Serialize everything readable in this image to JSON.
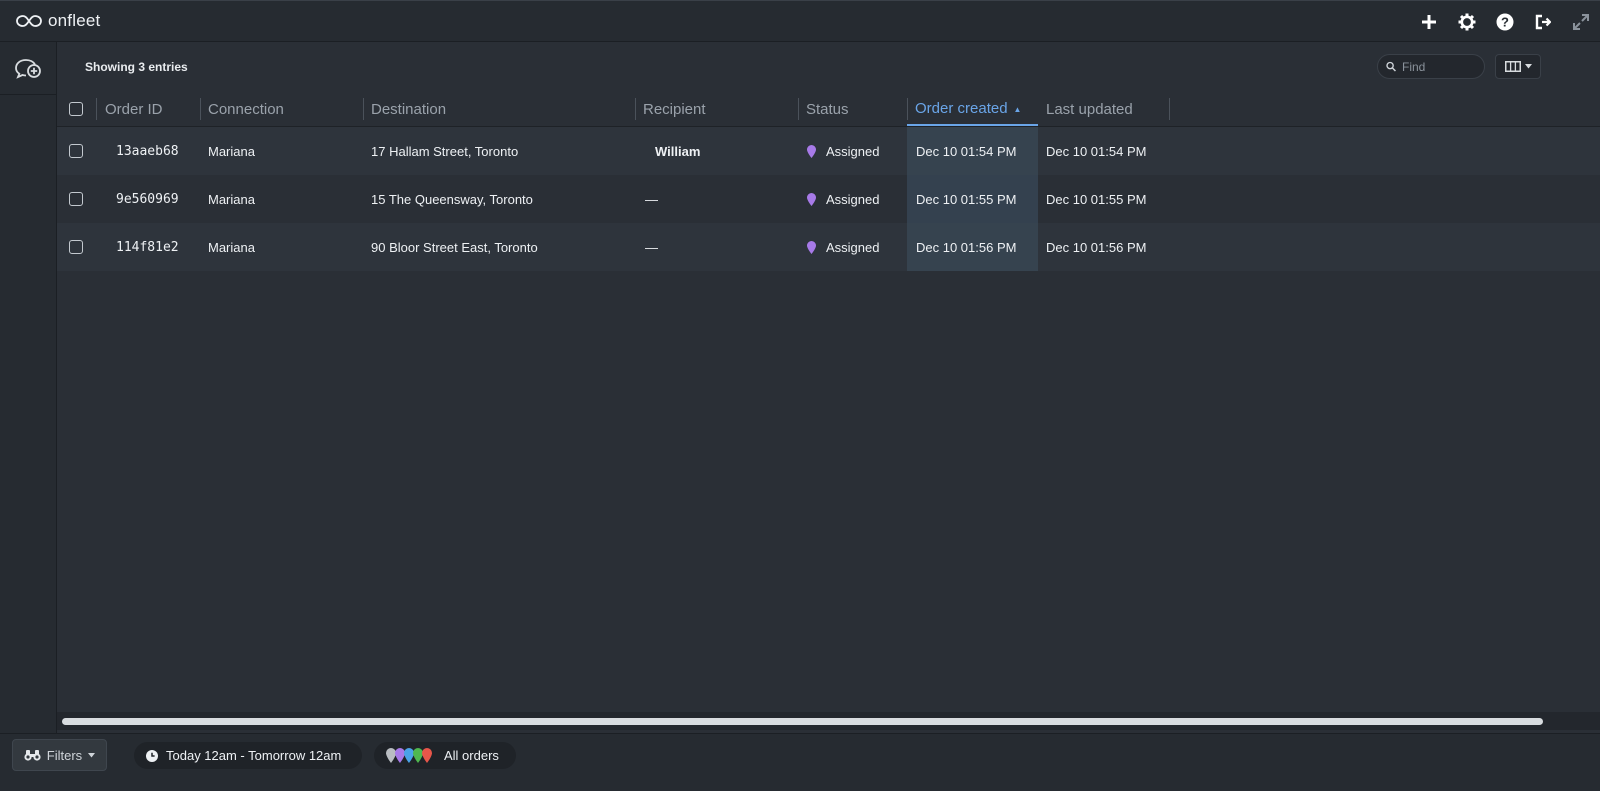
{
  "app": {
    "brand": "onfleet"
  },
  "toolbar": {
    "entries_text": "Showing 3 entries",
    "find_placeholder": "Find"
  },
  "table": {
    "columns": [
      "Order ID",
      "Connection",
      "Destination",
      "Recipient",
      "Status",
      "Order created",
      "Last updated"
    ],
    "sorted_column": "Order created",
    "sort_direction": "ascending",
    "rows": [
      {
        "order_id": "13aaeb68",
        "connection": "Mariana",
        "destination": "17 Hallam Street, Toronto",
        "recipient": "William",
        "status": "Assigned",
        "order_created": "Dec 10 01:54 PM",
        "last_updated": "Dec 10 01:54 PM"
      },
      {
        "order_id": "9e560969",
        "connection": "Mariana",
        "destination": "15 The Queensway, Toronto",
        "recipient": "—",
        "status": "Assigned",
        "order_created": "Dec 10 01:55 PM",
        "last_updated": "Dec 10 01:55 PM"
      },
      {
        "order_id": "114f81e2",
        "connection": "Mariana",
        "destination": "90 Bloor Street East, Toronto",
        "recipient": "—",
        "status": "Assigned",
        "order_created": "Dec 10 01:56 PM",
        "last_updated": "Dec 10 01:56 PM"
      }
    ]
  },
  "bottombar": {
    "filters_label": "Filters",
    "date_range": "Today 12am - Tomorrow 12am",
    "orders_label": "All orders",
    "pin_colors": [
      "#b9bdc2",
      "#a77ae8",
      "#4aa3e8",
      "#4fb84f",
      "#e8564a"
    ]
  },
  "colors": {
    "accent": "#6aa5e8",
    "assigned_pin": "#a77ae8"
  },
  "icons": {
    "top_actions": [
      "plus-icon",
      "gear-icon",
      "help-icon",
      "logout-icon",
      "expand-icon"
    ],
    "rail": [
      "add-order-icon"
    ]
  }
}
